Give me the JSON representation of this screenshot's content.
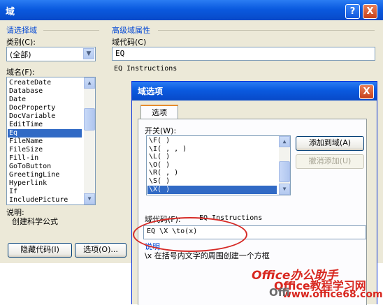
{
  "main_window": {
    "title": "域",
    "help_label": "?",
    "close_label": "X",
    "select_field_group": "请选择域",
    "category_label": "类别(C):",
    "category_value": "(全部)",
    "field_names_label": "域名(F):",
    "field_names": [
      "CreateDate",
      "Database",
      "Date",
      "DocProperty",
      "DocVariable",
      "EditTime",
      "Eq",
      "FileName",
      "FileSize",
      "Fill-in",
      "GoToButton",
      "GreetingLine",
      "Hyperlink",
      "If",
      "IncludePicture"
    ],
    "field_names_selected": "Eq",
    "description_label": "说明:",
    "description_text": "创建科学公式",
    "hide_codes_button": "隐藏代码(I)",
    "options_button": "选项(O)...",
    "advanced_group": "高级域属性",
    "field_codes_label": "域代码(C)",
    "field_codes_value": "EQ",
    "instructions_text": "EQ Instructions"
  },
  "options_dialog": {
    "title": "域选项",
    "close_label": "X",
    "tab_label": "选项",
    "switches_label": "开关(W):",
    "switches": [
      "\\F( )",
      "\\I( , , )",
      "\\L( )",
      "\\O( )",
      "\\R( , )",
      "\\S( )",
      "\\X( )"
    ],
    "switches_selected": "\\X( )",
    "add_button": "添加到域(A)",
    "undo_button": "撤消添加(U)",
    "field_codes_label": "域代码(F):",
    "field_codes_hint": "EQ Instructions",
    "field_codes_value": "EQ \\X \\to(x)",
    "description_label": "说明",
    "description_text": "\\x 在括号内文字的周围创建一个方框"
  },
  "watermark": {
    "line1": "Office办公助手",
    "line2": "Office教程学习网",
    "line3": "www.office68.com",
    "corner": "Offi"
  },
  "colors": {
    "titlebar": "#0a5adf",
    "selection": "#316ac5",
    "highlight_ellipse": "#d62a26",
    "watermark": "#d8271f"
  }
}
